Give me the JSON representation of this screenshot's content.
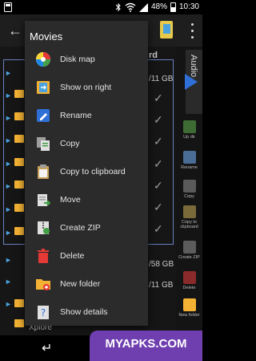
{
  "status_bar": {
    "battery": "48%",
    "time": "10:30",
    "icons": [
      "app-notification-icon",
      "bluetooth-icon",
      "wifi-icon",
      "signal-icon",
      "battery-icon"
    ]
  },
  "background": {
    "storage_hint_1": "/11 GB",
    "storage_hint_2": "/58 GB",
    "storage_hint_3": "/11 GB",
    "partial_label": "rd",
    "xplore": "Xplore",
    "audio_tab": "Audio",
    "toolbar": [
      "Up dir",
      "Rename",
      "Copy",
      "Copy to clipboard",
      "Create ZIP",
      "Delete",
      "New folder"
    ]
  },
  "menu": {
    "title": "Movies",
    "items": [
      {
        "label": "Disk map",
        "icon": "disk-map-icon"
      },
      {
        "label": "Show on right",
        "icon": "show-on-right-icon"
      },
      {
        "label": "Rename",
        "icon": "rename-icon"
      },
      {
        "label": "Copy",
        "icon": "copy-icon"
      },
      {
        "label": "Copy to clipboard",
        "icon": "clipboard-icon"
      },
      {
        "label": "Move",
        "icon": "move-icon"
      },
      {
        "label": "Create ZIP",
        "icon": "zip-icon"
      },
      {
        "label": "Delete",
        "icon": "trash-icon"
      },
      {
        "label": "New folder",
        "icon": "new-folder-icon"
      },
      {
        "label": "Show details",
        "icon": "details-icon"
      }
    ]
  },
  "watermark": "MYAPKS.COM",
  "colors": {
    "menu_bg": "#2b2b2b",
    "accent_blue": "#2f6fd8",
    "folder_yellow": "#f3b233",
    "delete_red": "#e53935",
    "watermark_purple": "#6f3fb0"
  }
}
